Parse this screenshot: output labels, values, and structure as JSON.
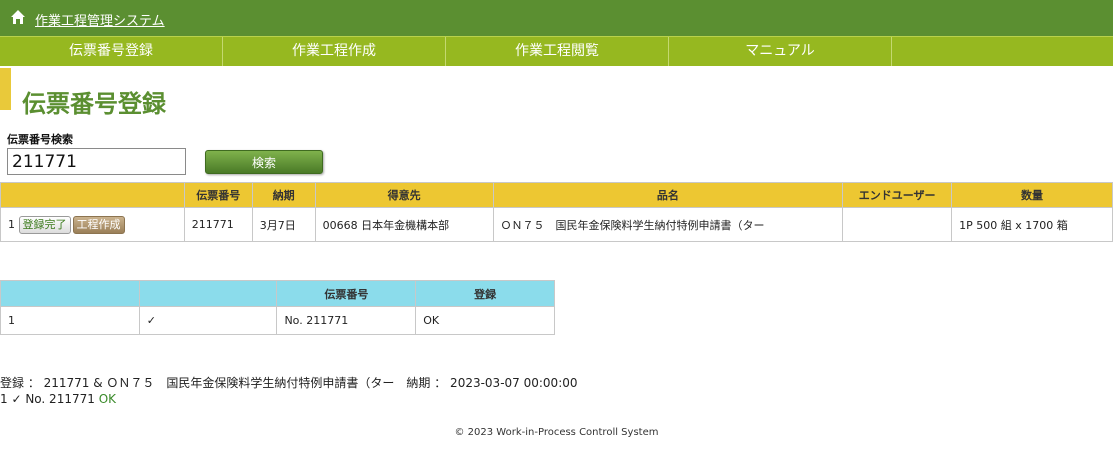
{
  "header": {
    "app_title": "作業工程管理システム",
    "icon": "home-icon"
  },
  "nav": [
    {
      "label": "伝票番号登録"
    },
    {
      "label": "作業工程作成"
    },
    {
      "label": "作業工程閲覧"
    },
    {
      "label": "マニュアル"
    },
    {
      "label": ""
    }
  ],
  "page_title": "伝票番号登録",
  "search": {
    "label": "伝票番号検索",
    "value": "211771",
    "button_label": "検索"
  },
  "result_table": {
    "headers": [
      "",
      "伝票番号",
      "納期",
      "得意先",
      "品名",
      "エンドユーザー",
      "数量"
    ],
    "row": {
      "index": "1",
      "done_button": "登録完了",
      "make_button": "工程作成",
      "slip_no": "211771",
      "due": "3月7日",
      "customer": "00668 日本年金機構本部",
      "product": "ＯＮ７５　国民年金保険料学生納付特例申請書（ター",
      "end_user": "",
      "quantity": "1P 500 組 x 1700 箱"
    }
  },
  "register_table": {
    "headers": [
      "",
      "",
      "伝票番号",
      "登録"
    ],
    "row": {
      "index": "1",
      "check": "✓",
      "slip_no": "No. 211771",
      "status": "OK"
    }
  },
  "log": {
    "line1": "登録 ： 211771 & ＯＮ７５　国民年金保険料学生納付特例申請書（ター　納期 ： 2023-03-07 00:00:00",
    "line2_prefix": "1  ✓  No. 211771 ",
    "line2_status": "OK"
  },
  "footer": "© 2023 Work-in-Process Controll System",
  "colors": {
    "header_green": "#5b8f31",
    "nav_green": "#96b820",
    "accent_yellow": "#edc732",
    "table2_header": "#8bdceb"
  }
}
